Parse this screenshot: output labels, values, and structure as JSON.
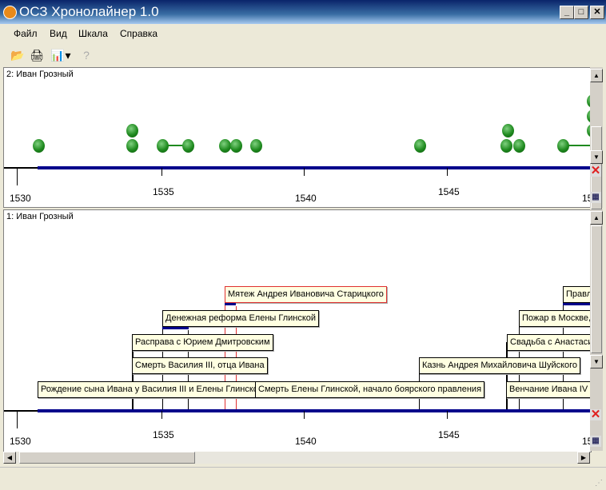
{
  "window": {
    "title": "ОСЗ Хронолайнер 1.0",
    "min": "_",
    "max": "□",
    "close": "✕"
  },
  "menu": [
    "Файл",
    "Вид",
    "Шкала",
    "Справка"
  ],
  "toolbar": {
    "open": "📂",
    "print": "🖨",
    "chart": "📊",
    "dropdown": "▾",
    "help": "?"
  },
  "panel_top": {
    "label": "2: Иван Грозный",
    "years": [
      "1530",
      "1535",
      "1540",
      "1545",
      "15"
    ]
  },
  "panel_bottom": {
    "label": "1: Иван Грозный",
    "years": [
      "1530",
      "1535",
      "1540",
      "1545",
      "15"
    ],
    "events": [
      "Рождение сына Ивана у Василия III и Елены Глинской",
      "Смерть Василия III, отца Ивана",
      "Расправа с Юрием Дмитровским",
      "Денежная реформа Елены Глинской",
      "Мятеж Андрея Ивановича Старицкого",
      "Смерть Елены Глинской, начало боярского правления",
      "Казнь Андрея Михайловича Шуйского",
      "Венчание Ивана IV на ц",
      "Свадьба с Анастасией",
      "Пожар в Москве, м",
      "Правле"
    ]
  },
  "colors": {
    "axis": "#00008b",
    "dot": "#1f8a1f",
    "event_bg": "#ffffe1",
    "selected_border": "#e03030"
  }
}
